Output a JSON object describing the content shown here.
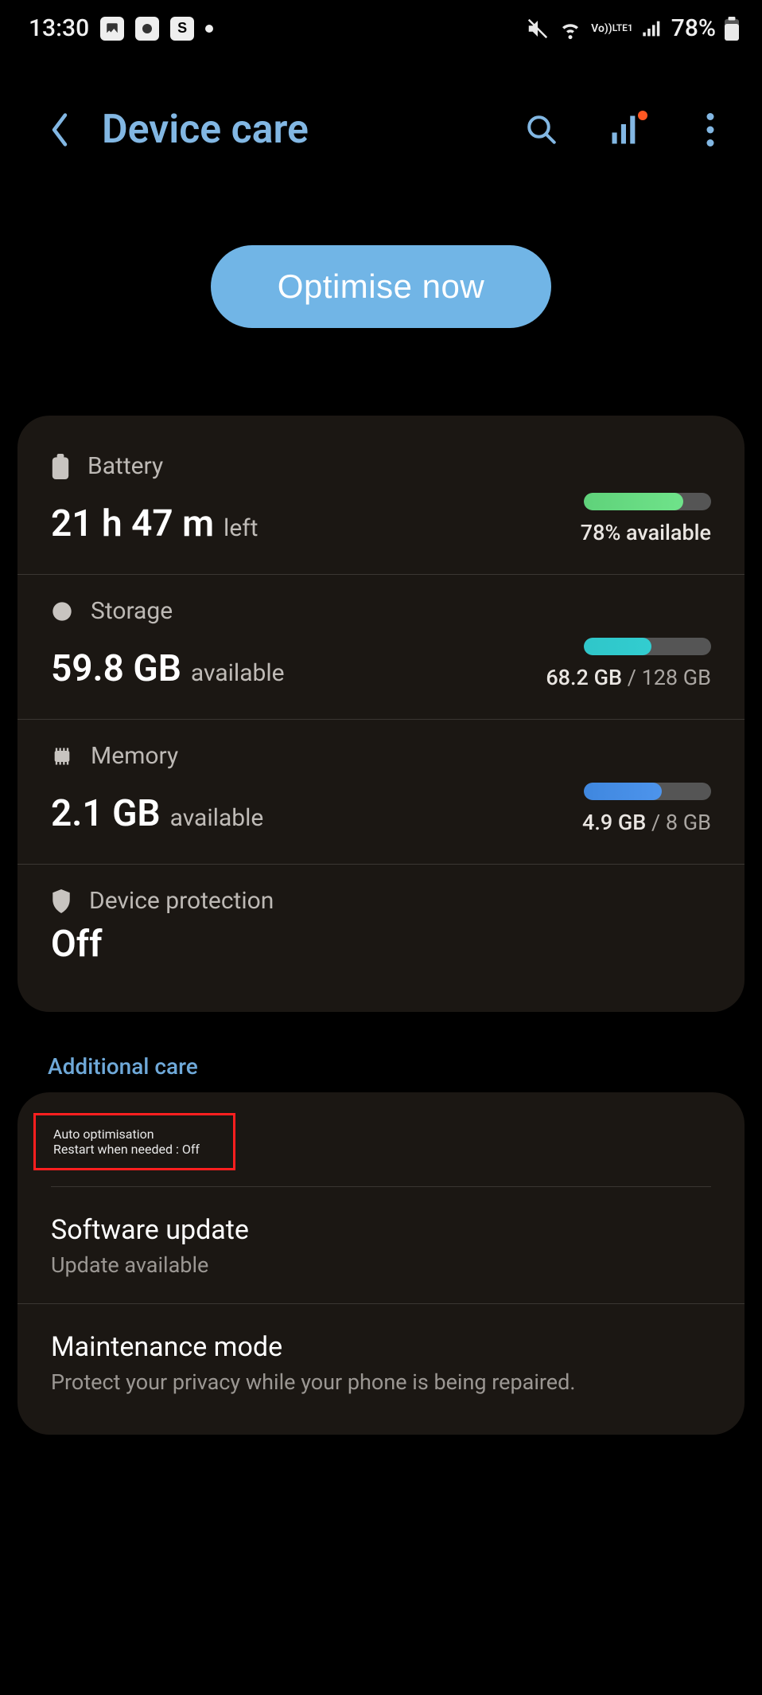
{
  "status": {
    "time": "13:30",
    "battery_pct": "78%"
  },
  "header": {
    "title": "Device care"
  },
  "action": {
    "optimise_label": "Optimise now"
  },
  "battery": {
    "label": "Battery",
    "value": "21 h 47 m",
    "suffix": "left",
    "right": "78% available",
    "fill_pct": 78
  },
  "storage": {
    "label": "Storage",
    "value": "59.8 GB",
    "suffix": "available",
    "used": "68.2 GB",
    "total": "128 GB",
    "fill_pct": 53
  },
  "memory": {
    "label": "Memory",
    "value": "2.1 GB",
    "suffix": "available",
    "used": "4.9 GB",
    "total": "8 GB",
    "fill_pct": 61
  },
  "protection": {
    "label": "Device protection",
    "value": "Off"
  },
  "section_additional": "Additional care",
  "auto_opt": {
    "title": "Auto optimisation",
    "sub": "Restart when needed : Off"
  },
  "software": {
    "title": "Software update",
    "sub": "Update available"
  },
  "maintenance": {
    "title": "Maintenance mode",
    "sub": "Protect your privacy while your phone is being repaired."
  }
}
